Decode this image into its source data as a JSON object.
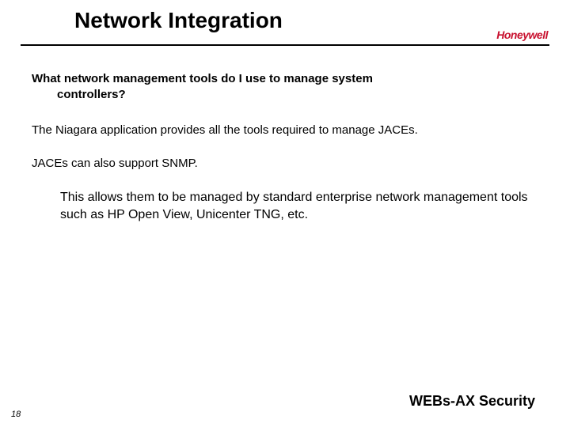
{
  "header": {
    "title": "Network Integration",
    "brand": "Honeywell"
  },
  "content": {
    "question_line1": "What network management tools do I use to manage system",
    "question_line2": "controllers?",
    "para1": "The Niagara application provides all the tools required to manage JACEs.",
    "para2": "JACEs can also support SNMP.",
    "para3": "This allows them to be managed by standard enterprise network management tools such as HP Open View, Unicenter TNG, etc."
  },
  "footer": {
    "title": "WEBs-AX Security",
    "page_number": "18"
  }
}
